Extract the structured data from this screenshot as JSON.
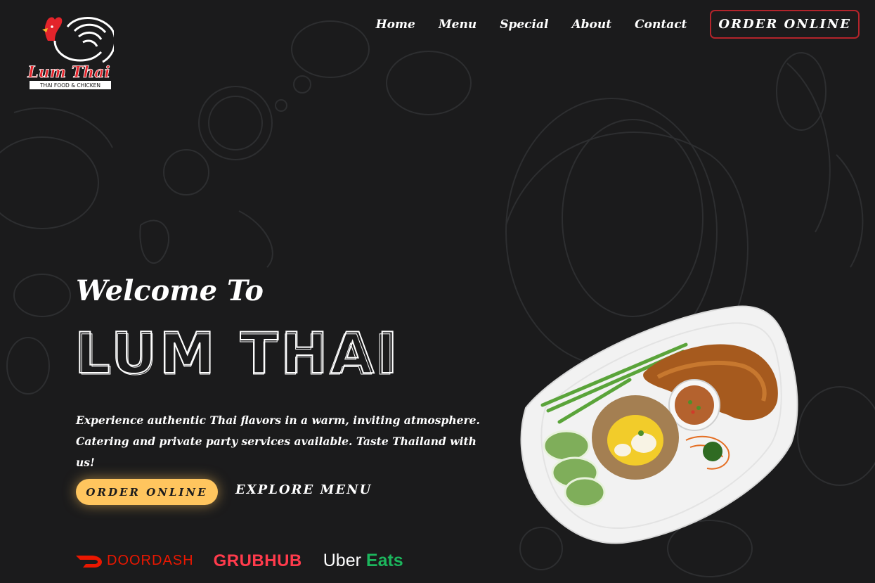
{
  "logo": {
    "title": "Lum Thai",
    "subtitle": "THAI FOOD & CHICKEN"
  },
  "nav": {
    "links": [
      "Home",
      "Menu",
      "Special",
      "About",
      "Contact"
    ],
    "order_button": "ORDER ONLINE"
  },
  "hero": {
    "welcome": "Welcome To",
    "brand": "LUM THAI",
    "tagline_line1": "Experience authentic Thai flavors in a warm, inviting atmosphere.",
    "tagline_line2": "Catering and private party services available. Taste Thailand with us!",
    "order_button": "ORDER ONLINE",
    "menu_button": "EXPLORE MENU"
  },
  "delivery": {
    "doordash": "DOORDASH",
    "grubhub": "GRUBHUB",
    "ubereats_a": "Uber",
    "ubereats_b": "Eats"
  },
  "icons": [
    "rooster-logo",
    "doordash-icon",
    "dish-image"
  ],
  "colors": {
    "background": "#1b1b1c",
    "accent_yellow": "#ffc55e",
    "nav_border": "#b3242b",
    "doordash": "#eb1700",
    "grubhub": "#ff3b4c",
    "ubereats_green": "#1cb65d"
  }
}
